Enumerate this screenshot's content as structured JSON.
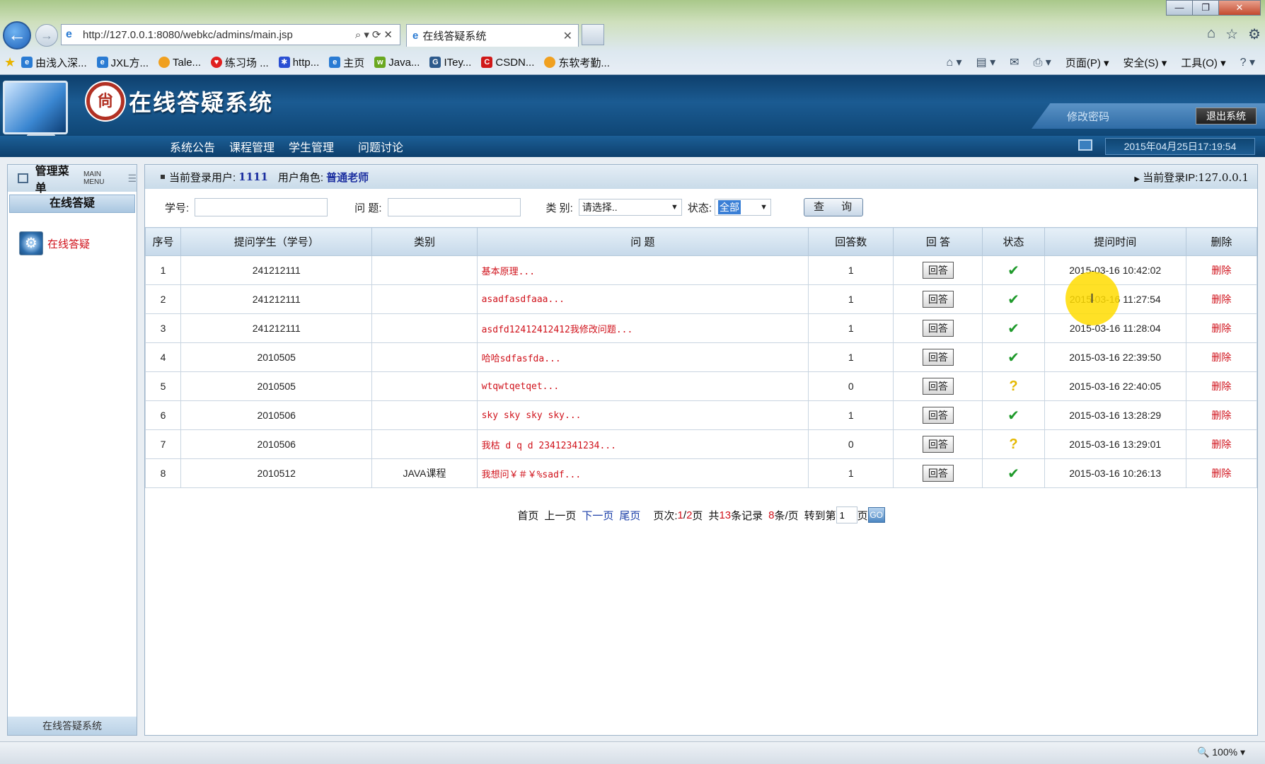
{
  "browser": {
    "url": "http://127.0.0.1:8080/webkc/admins/main.jsp",
    "tab_title": "在线答疑系统",
    "favorites": [
      "由浅入深...",
      "JXL方...",
      "Tale...",
      "练习场 ...",
      "http...",
      "主页",
      "Java...",
      "ITey...",
      "CSDN...",
      "东软考勤..."
    ],
    "commands": [
      "页面(P)",
      "安全(S)",
      "工具(O)"
    ],
    "zoom": "100%"
  },
  "app": {
    "title": "在线答疑系统",
    "seal_char": "尙",
    "change_password": "修改密码",
    "logout": "退出系统",
    "menu": [
      "系统公告",
      "课程管理",
      "学生管理",
      "问题讨论"
    ],
    "datetime": "2015年04月25日17:19:54"
  },
  "sidebar": {
    "title": "管理菜单",
    "title_en": "MAIN MENU",
    "section": "在线答疑",
    "item": "在线答疑",
    "footer": "在线答疑系统"
  },
  "infobar": {
    "user_label": "当前登录用户:",
    "user": "1111",
    "role_label": "用户角色:",
    "role": "普通老师",
    "ip_label": "当前登录IP:",
    "ip": "127.0.0.1"
  },
  "search": {
    "student_label": "学号:",
    "student_value": "",
    "question_label": "问 题:",
    "question_value": "",
    "category_label": "类 别:",
    "category_value": "请选择..",
    "status_label": "状态:",
    "status_value": "全部",
    "button": "查 询"
  },
  "table": {
    "headers": [
      "序号",
      "提问学生（学号）",
      "类别",
      "问 题",
      "回答数",
      "回 答",
      "状态",
      "提问时间",
      "删除"
    ],
    "answer_label": "回答",
    "delete_label": "删除",
    "rows": [
      {
        "no": "1",
        "student": "241212111",
        "category": "",
        "question": "基本原理...",
        "answers": "1",
        "status": "answered",
        "time": "2015-03-16 10:42:02"
      },
      {
        "no": "2",
        "student": "241212111",
        "category": "",
        "question": "asadfasdfaaa...",
        "answers": "1",
        "status": "answered",
        "time": "2015-03-16 11:27:54"
      },
      {
        "no": "3",
        "student": "241212111",
        "category": "",
        "question": "asdfd12412412412我修改问题...",
        "answers": "1",
        "status": "answered",
        "time": "2015-03-16 11:28:04"
      },
      {
        "no": "4",
        "student": "2010505",
        "category": "",
        "question": "哈哈sdfasfda...",
        "answers": "1",
        "status": "answered",
        "time": "2015-03-16 22:39:50"
      },
      {
        "no": "5",
        "student": "2010505",
        "category": "",
        "question": "wtqwtqetqet...",
        "answers": "0",
        "status": "pending",
        "time": "2015-03-16 22:40:05"
      },
      {
        "no": "6",
        "student": "2010506",
        "category": "",
        "question": "sky sky sky sky...",
        "answers": "1",
        "status": "answered",
        "time": "2015-03-16 13:28:29"
      },
      {
        "no": "7",
        "student": "2010506",
        "category": "",
        "question": "我枯    d q d 23412341234...",
        "answers": "0",
        "status": "pending",
        "time": "2015-03-16 13:29:01"
      },
      {
        "no": "8",
        "student": "2010512",
        "category": "JAVA课程",
        "question": "我想问￥＃￥%sadf...",
        "answers": "1",
        "status": "answered",
        "time": "2015-03-16 10:26:13"
      }
    ]
  },
  "pager": {
    "first": "首页",
    "prev": "上一页",
    "next": "下一页",
    "last": "尾页",
    "page_label": "页次:",
    "page_current": "1",
    "page_total": "2",
    "page_unit": "页",
    "total_prefix": "共",
    "total_records": "13",
    "total_suffix": "条记录",
    "per_page": "8",
    "per_page_suffix": "条/页",
    "goto_prefix": "转到第",
    "goto_value": "1",
    "goto_suffix": "页",
    "go_button": "GO"
  },
  "colors": {
    "header_blue": "#1b5b92",
    "link_red": "#d0121b",
    "link_blue": "#1c3fa8",
    "check_green": "#1f9a2b",
    "pending_yellow": "#e5b800"
  }
}
